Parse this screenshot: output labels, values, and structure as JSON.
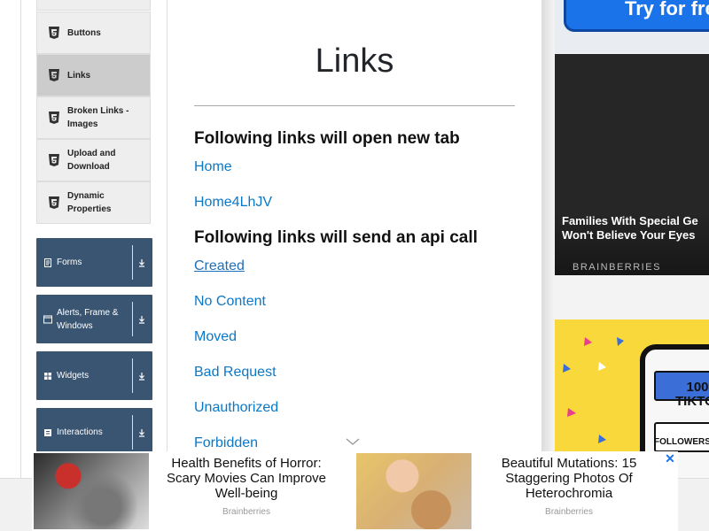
{
  "sidebar": {
    "items": [
      {
        "label": "Buttons"
      },
      {
        "label": "Links"
      },
      {
        "label": "Broken Links - Images"
      },
      {
        "label": "Upload and Download"
      },
      {
        "label": "Dynamic Properties"
      }
    ],
    "groups": [
      {
        "label": "Forms",
        "icon": "form-icon"
      },
      {
        "label": "Alerts, Frame & Windows",
        "icon": "window-icon"
      },
      {
        "label": "Widgets",
        "icon": "widgets-icon"
      },
      {
        "label": "Interactions",
        "icon": "interactions-icon"
      }
    ]
  },
  "main": {
    "title": "Links",
    "section1_heading": "Following links will open new tab",
    "new_tab_links": [
      "Home",
      "Home4LhJV"
    ],
    "section2_heading": "Following links will send an api call",
    "api_links": [
      "Created",
      "No Content",
      "Moved",
      "Bad Request",
      "Unauthorized",
      "Forbidden"
    ]
  },
  "ads": {
    "top_button": "Try for free",
    "mid_headline_line1": "Families With Special Ge",
    "mid_headline_line2": "Won't Believe Your Eyes",
    "mid_brand": "BRAINBERRIES",
    "phone_line1": "100",
    "phone_line2": "TIKTOK",
    "phone_line3": "FOLLOWERS",
    "bottom": [
      {
        "title": "Health Benefits of Horror: Scary Movies Can Improve Well-being",
        "source": "Brainberries"
      },
      {
        "title": "Beautiful Mutations: 15 Staggering Photos Of Heterochromia",
        "source": "Brainberries"
      }
    ],
    "close": "✕"
  },
  "colors": {
    "link": "#0a78c8",
    "nav_group": "#3a5572",
    "accent_ad": "#1a73e8"
  }
}
